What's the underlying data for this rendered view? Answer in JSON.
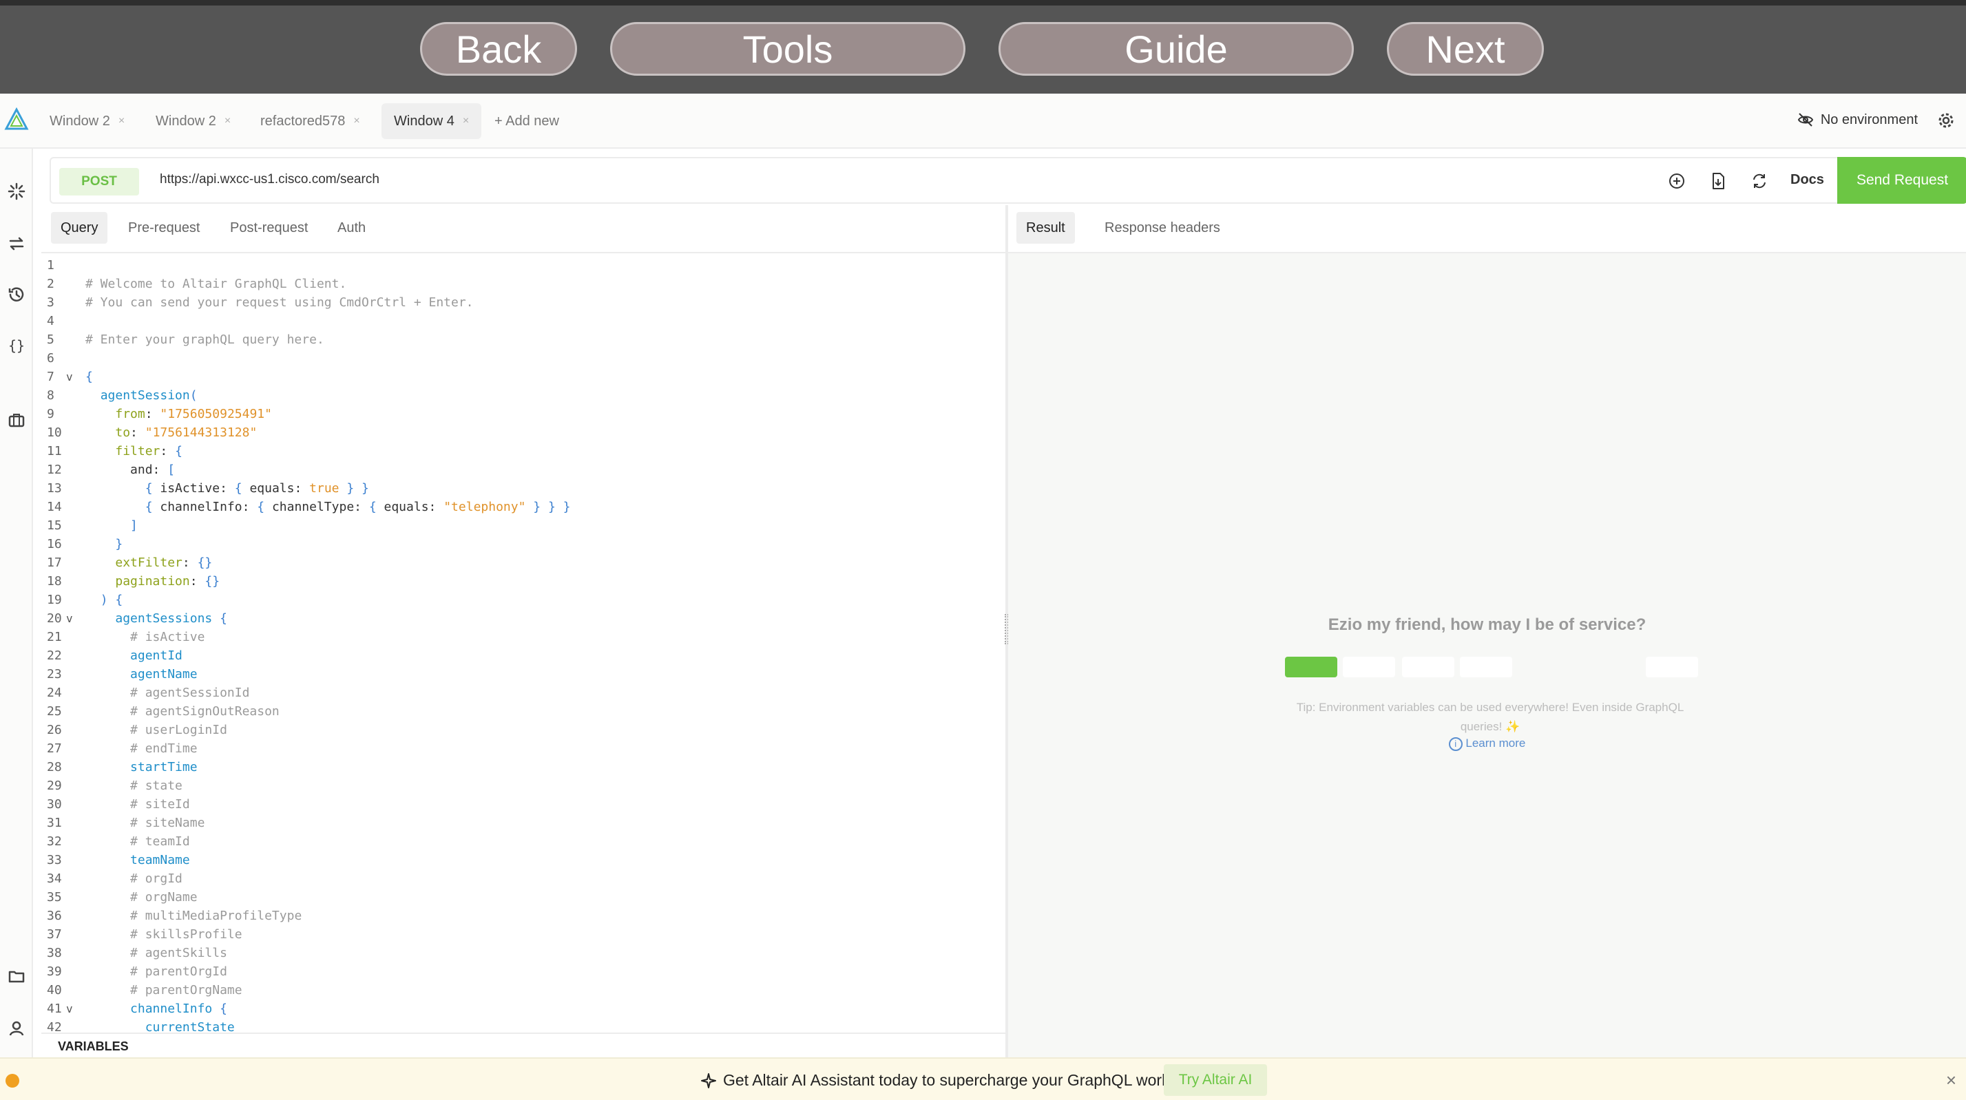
{
  "nav": {
    "back": "Back",
    "tools": "Tools",
    "guide": "Guide",
    "next": "Next"
  },
  "tabs": [
    {
      "label": "Window 2"
    },
    {
      "label": "Window 2"
    },
    {
      "label": "refactored578"
    },
    {
      "label": "Window 4"
    }
  ],
  "tab_close": "×",
  "add_new": "+ Add new",
  "environment": "No environment",
  "request": {
    "method": "POST",
    "url": "https://api.wxcc-us1.cisco.com/search",
    "docs": "Docs",
    "send": "Send Request"
  },
  "query_tabs": [
    "Query",
    "Pre-request",
    "Post-request",
    "Auth"
  ],
  "result_tabs": [
    "Result",
    "Response headers"
  ],
  "editor_lines": [
    [],
    [
      [
        "c",
        "# Welcome to Altair GraphQL Client."
      ]
    ],
    [
      [
        "c",
        "# You can send your request using CmdOrCtrl + Enter."
      ]
    ],
    [],
    [
      [
        "c",
        "# Enter your graphQL query here."
      ]
    ],
    [],
    [
      [
        "p",
        "{"
      ]
    ],
    [
      [
        "x",
        "  "
      ],
      [
        "f",
        "agentSession"
      ],
      [
        "p",
        "("
      ]
    ],
    [
      [
        "x",
        "    "
      ],
      [
        "a",
        "from"
      ],
      [
        "x",
        ": "
      ],
      [
        "s",
        "\"1756050925491\""
      ]
    ],
    [
      [
        "x",
        "    "
      ],
      [
        "a",
        "to"
      ],
      [
        "x",
        ": "
      ],
      [
        "s",
        "\"1756144313128\""
      ]
    ],
    [
      [
        "x",
        "    "
      ],
      [
        "a",
        "filter"
      ],
      [
        "x",
        ": "
      ],
      [
        "p",
        "{"
      ]
    ],
    [
      [
        "x",
        "      and: "
      ],
      [
        "p",
        "["
      ]
    ],
    [
      [
        "x",
        "        "
      ],
      [
        "p",
        "{"
      ],
      [
        "x",
        " isActive: "
      ],
      [
        "p",
        "{"
      ],
      [
        "x",
        " equals: "
      ],
      [
        "s",
        "true"
      ],
      [
        "x",
        " "
      ],
      [
        "p",
        "}"
      ],
      [
        "x",
        " "
      ],
      [
        "p",
        "}"
      ]
    ],
    [
      [
        "x",
        "        "
      ],
      [
        "p",
        "{"
      ],
      [
        "x",
        " channelInfo: "
      ],
      [
        "p",
        "{"
      ],
      [
        "x",
        " channelType: "
      ],
      [
        "p",
        "{"
      ],
      [
        "x",
        " equals: "
      ],
      [
        "s",
        "\"telephony\""
      ],
      [
        "x",
        " "
      ],
      [
        "p",
        "}"
      ],
      [
        "x",
        " "
      ],
      [
        "p",
        "}"
      ],
      [
        "x",
        " "
      ],
      [
        "p",
        "}"
      ]
    ],
    [
      [
        "x",
        "      "
      ],
      [
        "p",
        "]"
      ]
    ],
    [
      [
        "x",
        "    "
      ],
      [
        "p",
        "}"
      ]
    ],
    [
      [
        "x",
        "    "
      ],
      [
        "a",
        "extFilter"
      ],
      [
        "x",
        ": "
      ],
      [
        "p",
        "{}"
      ]
    ],
    [
      [
        "x",
        "    "
      ],
      [
        "a",
        "pagination"
      ],
      [
        "x",
        ": "
      ],
      [
        "p",
        "{}"
      ]
    ],
    [
      [
        "x",
        "  "
      ],
      [
        "p",
        ") {"
      ]
    ],
    [
      [
        "x",
        "    "
      ],
      [
        "f",
        "agentSessions"
      ],
      [
        "x",
        " "
      ],
      [
        "p",
        "{"
      ]
    ],
    [
      [
        "x",
        "      "
      ],
      [
        "c",
        "# isActive"
      ]
    ],
    [
      [
        "x",
        "      "
      ],
      [
        "f",
        "agentId"
      ]
    ],
    [
      [
        "x",
        "      "
      ],
      [
        "f",
        "agentName"
      ]
    ],
    [
      [
        "x",
        "      "
      ],
      [
        "c",
        "# agentSessionId"
      ]
    ],
    [
      [
        "x",
        "      "
      ],
      [
        "c",
        "# agentSignOutReason"
      ]
    ],
    [
      [
        "x",
        "      "
      ],
      [
        "c",
        "# userLoginId"
      ]
    ],
    [
      [
        "x",
        "      "
      ],
      [
        "c",
        "# endTime"
      ]
    ],
    [
      [
        "x",
        "      "
      ],
      [
        "f",
        "startTime"
      ]
    ],
    [
      [
        "x",
        "      "
      ],
      [
        "c",
        "# state"
      ]
    ],
    [
      [
        "x",
        "      "
      ],
      [
        "c",
        "# siteId"
      ]
    ],
    [
      [
        "x",
        "      "
      ],
      [
        "c",
        "# siteName"
      ]
    ],
    [
      [
        "x",
        "      "
      ],
      [
        "c",
        "# teamId"
      ]
    ],
    [
      [
        "x",
        "      "
      ],
      [
        "f",
        "teamName"
      ]
    ],
    [
      [
        "x",
        "      "
      ],
      [
        "c",
        "# orgId"
      ]
    ],
    [
      [
        "x",
        "      "
      ],
      [
        "c",
        "# orgName"
      ]
    ],
    [
      [
        "x",
        "      "
      ],
      [
        "c",
        "# multiMediaProfileType"
      ]
    ],
    [
      [
        "x",
        "      "
      ],
      [
        "c",
        "# skillsProfile"
      ]
    ],
    [
      [
        "x",
        "      "
      ],
      [
        "c",
        "# agentSkills"
      ]
    ],
    [
      [
        "x",
        "      "
      ],
      [
        "c",
        "# parentOrgId"
      ]
    ],
    [
      [
        "x",
        "      "
      ],
      [
        "c",
        "# parentOrgName"
      ]
    ],
    [
      [
        "x",
        "      "
      ],
      [
        "f",
        "channelInfo"
      ],
      [
        "x",
        " "
      ],
      [
        "p",
        "{"
      ]
    ],
    [
      [
        "x",
        "        "
      ],
      [
        "f",
        "currentState"
      ]
    ]
  ],
  "fold_lines": [
    7,
    20,
    41
  ],
  "fold_marker": "v",
  "variables_label": "VARIABLES",
  "result": {
    "welcome": "Ezio my friend, how may I be of service?",
    "tip": "Tip: Environment variables can be used everywhere! Even inside GraphQL queries! ✨",
    "learn_more": "Learn more"
  },
  "banner": {
    "text": "Get Altair AI Assistant today to supercharge your GraphQL workflow!",
    "button": "Try Altair AI",
    "close": "×"
  },
  "colors": {
    "accent_green": "#6cc644",
    "nav_button": "#9b8d8d",
    "topbar": "#555555"
  }
}
